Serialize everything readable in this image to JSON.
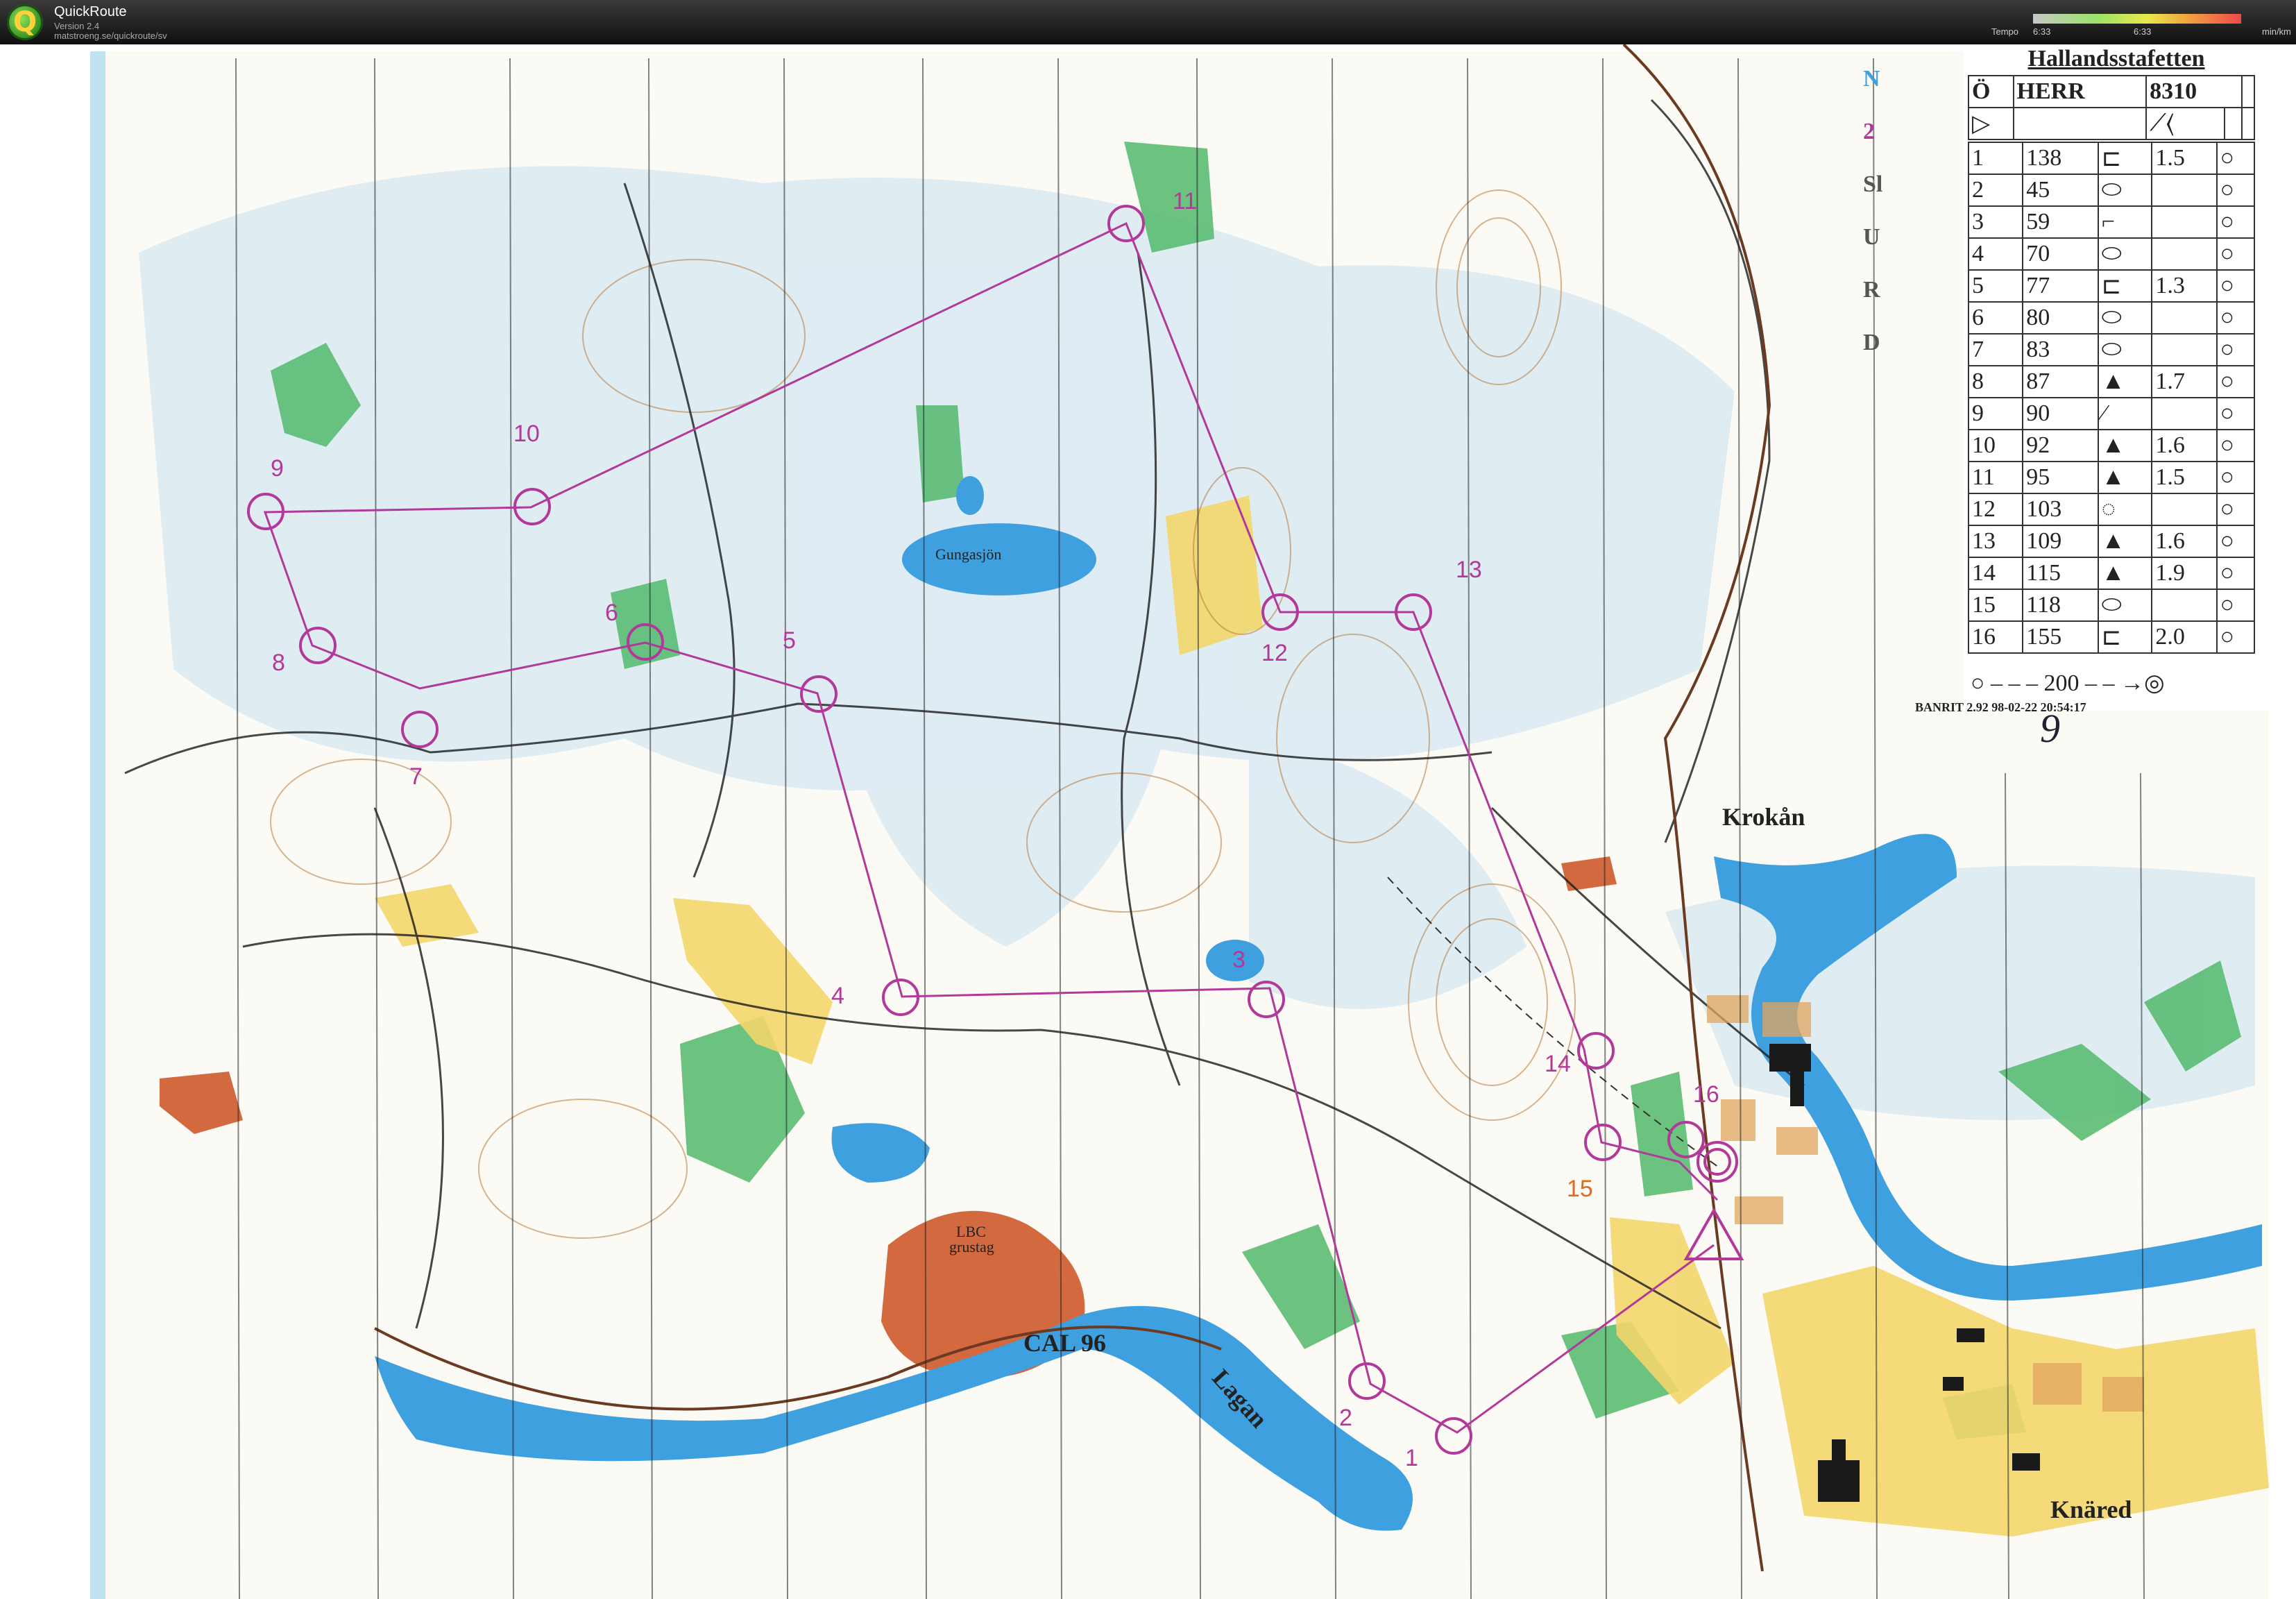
{
  "app": {
    "title": "QuickRoute",
    "version": "Version 2.4",
    "url": "matstroeng.se/quickroute/sv",
    "logo_letter": "Q"
  },
  "tempo": {
    "label": "Tempo",
    "min_value": "6:33",
    "max_value": "6:33",
    "unit": "min/km"
  },
  "map": {
    "lake_label": "Gungasjön",
    "places": {
      "krokan": "Krokån",
      "knared": "Knäred",
      "cal96": "CAL 96",
      "lagan": "Lagan",
      "lbc": "LBC",
      "grustag": "grustag"
    },
    "controls": [
      "1",
      "2",
      "3",
      "4",
      "5",
      "6",
      "7",
      "8",
      "9",
      "10",
      "11",
      "12",
      "13",
      "14",
      "15",
      "16"
    ],
    "side_letters": [
      "N",
      "2",
      "Sl",
      "U",
      "R",
      "D"
    ]
  },
  "description_sheet": {
    "title": "Hallandsstafetten",
    "class": "HERR",
    "code": "8310",
    "class_symbol": "Ö",
    "rows": [
      {
        "n": "1",
        "code": "138",
        "dist": "1.5"
      },
      {
        "n": "2",
        "code": "45",
        "dist": ""
      },
      {
        "n": "3",
        "code": "59",
        "dist": ""
      },
      {
        "n": "4",
        "code": "70",
        "dist": ""
      },
      {
        "n": "5",
        "code": "77",
        "dist": "1.3"
      },
      {
        "n": "6",
        "code": "80",
        "dist": ""
      },
      {
        "n": "7",
        "code": "83",
        "dist": ""
      },
      {
        "n": "8",
        "code": "87",
        "dist": "1.7"
      },
      {
        "n": "9",
        "code": "90",
        "dist": ""
      },
      {
        "n": "10",
        "code": "92",
        "dist": "1.6"
      },
      {
        "n": "11",
        "code": "95",
        "dist": "1.5"
      },
      {
        "n": "12",
        "code": "103",
        "dist": ""
      },
      {
        "n": "13",
        "code": "109",
        "dist": "1.6"
      },
      {
        "n": "14",
        "code": "115",
        "dist": "1.9"
      },
      {
        "n": "15",
        "code": "118",
        "dist": ""
      },
      {
        "n": "16",
        "code": "155",
        "dist": "2.0"
      }
    ],
    "finish_distance": "200",
    "banrit": "BANRIT 2.92 98-02-22 20:54:17",
    "signature": "9"
  }
}
